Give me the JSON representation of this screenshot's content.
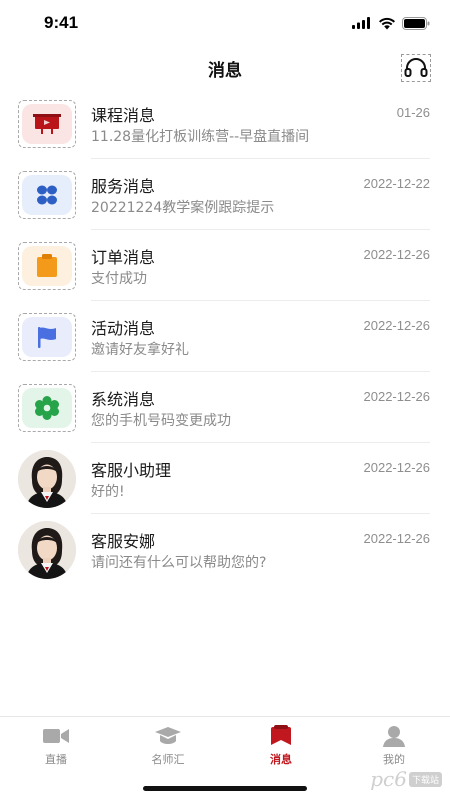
{
  "status_bar": {
    "time": "9:41"
  },
  "header": {
    "title": "消息",
    "support_icon": "headset-icon"
  },
  "messages": [
    {
      "title": "课程消息",
      "preview": "11.28量化打板训练营--早盘直播间",
      "date": "01-26",
      "icon": "course-icon",
      "tile_color": "#fbe4e4",
      "icon_color": "#b8141a"
    },
    {
      "title": "服务消息",
      "preview": "20221224教学案例跟踪提示",
      "date": "2022-12-22",
      "icon": "service-icon",
      "tile_color": "#e6eefb",
      "icon_color": "#2d5fc4"
    },
    {
      "title": "订单消息",
      "preview": "支付成功",
      "date": "2022-12-26",
      "icon": "order-icon",
      "tile_color": "#fdf0df",
      "icon_color": "#f39a1b"
    },
    {
      "title": "活动消息",
      "preview": "邀请好友拿好礼",
      "date": "2022-12-26",
      "icon": "flag-icon",
      "tile_color": "#e8ecfb",
      "icon_color": "#4a6fe0"
    },
    {
      "title": "系统消息",
      "preview": "您的手机号码变更成功",
      "date": "2022-12-26",
      "icon": "gear-icon",
      "tile_color": "#e3f5e8",
      "icon_color": "#27a34a"
    },
    {
      "title": "客服小助理",
      "preview": "好的!",
      "date": "2022-12-26",
      "icon": "agent-avatar"
    },
    {
      "title": "客服安娜",
      "preview": "请问还有什么可以帮助您的?",
      "date": "2022-12-26",
      "icon": "agent-avatar"
    }
  ],
  "tabs": [
    {
      "label": "直播",
      "icon": "video-camera-icon",
      "active": false
    },
    {
      "label": "名师汇",
      "icon": "graduation-cap-icon",
      "active": false
    },
    {
      "label": "消息",
      "icon": "message-icon",
      "active": true
    },
    {
      "label": "我的",
      "icon": "user-icon",
      "active": false
    }
  ],
  "colors": {
    "accent": "#c0181e",
    "divider": "#ececec",
    "muted_text": "#8a8a8a"
  },
  "watermark": {
    "text": "pc6",
    "badge": "下载站"
  }
}
